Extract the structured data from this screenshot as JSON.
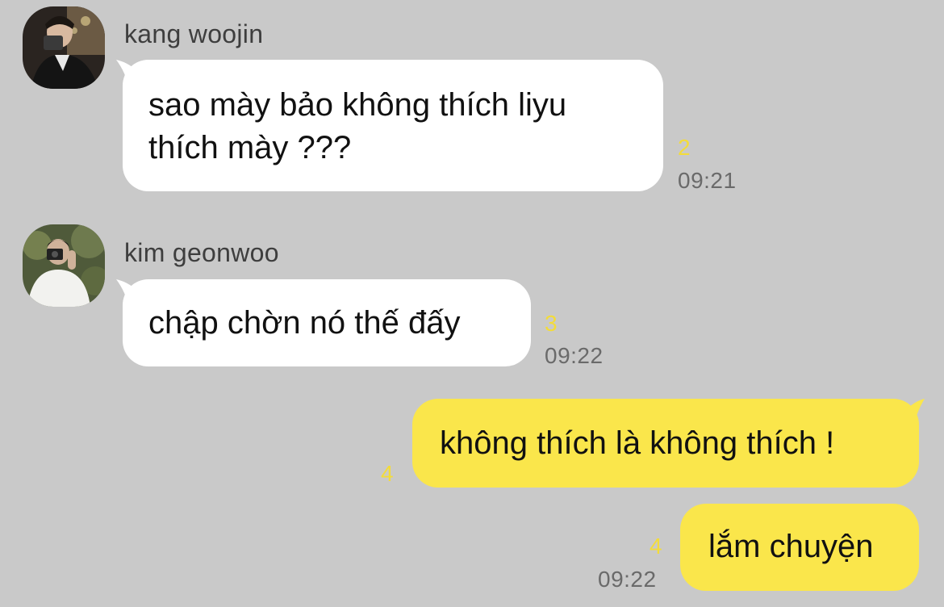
{
  "colors": {
    "background": "#c9c9c9",
    "incoming_bubble": "#ffffff",
    "outgoing_bubble": "#fae64b",
    "unread_count": "#f3dc3a",
    "timestamp": "#6a6a6a"
  },
  "messages": [
    {
      "sender": "kang woojin",
      "avatar": "photo-avatar",
      "text_line1": "sao mày bảo không thích liyu",
      "text_line2": "thích mày ???",
      "unread": "2",
      "time": "09:21"
    },
    {
      "sender": "kim geonwoo",
      "avatar": "photo-avatar",
      "text": "chập chờn nó thế đấy",
      "unread": "3",
      "time": "09:22"
    },
    {
      "text": "không thích là không thích !",
      "unread": "4"
    },
    {
      "text": "lắm chuyện",
      "unread": "4",
      "time": "09:22"
    }
  ]
}
